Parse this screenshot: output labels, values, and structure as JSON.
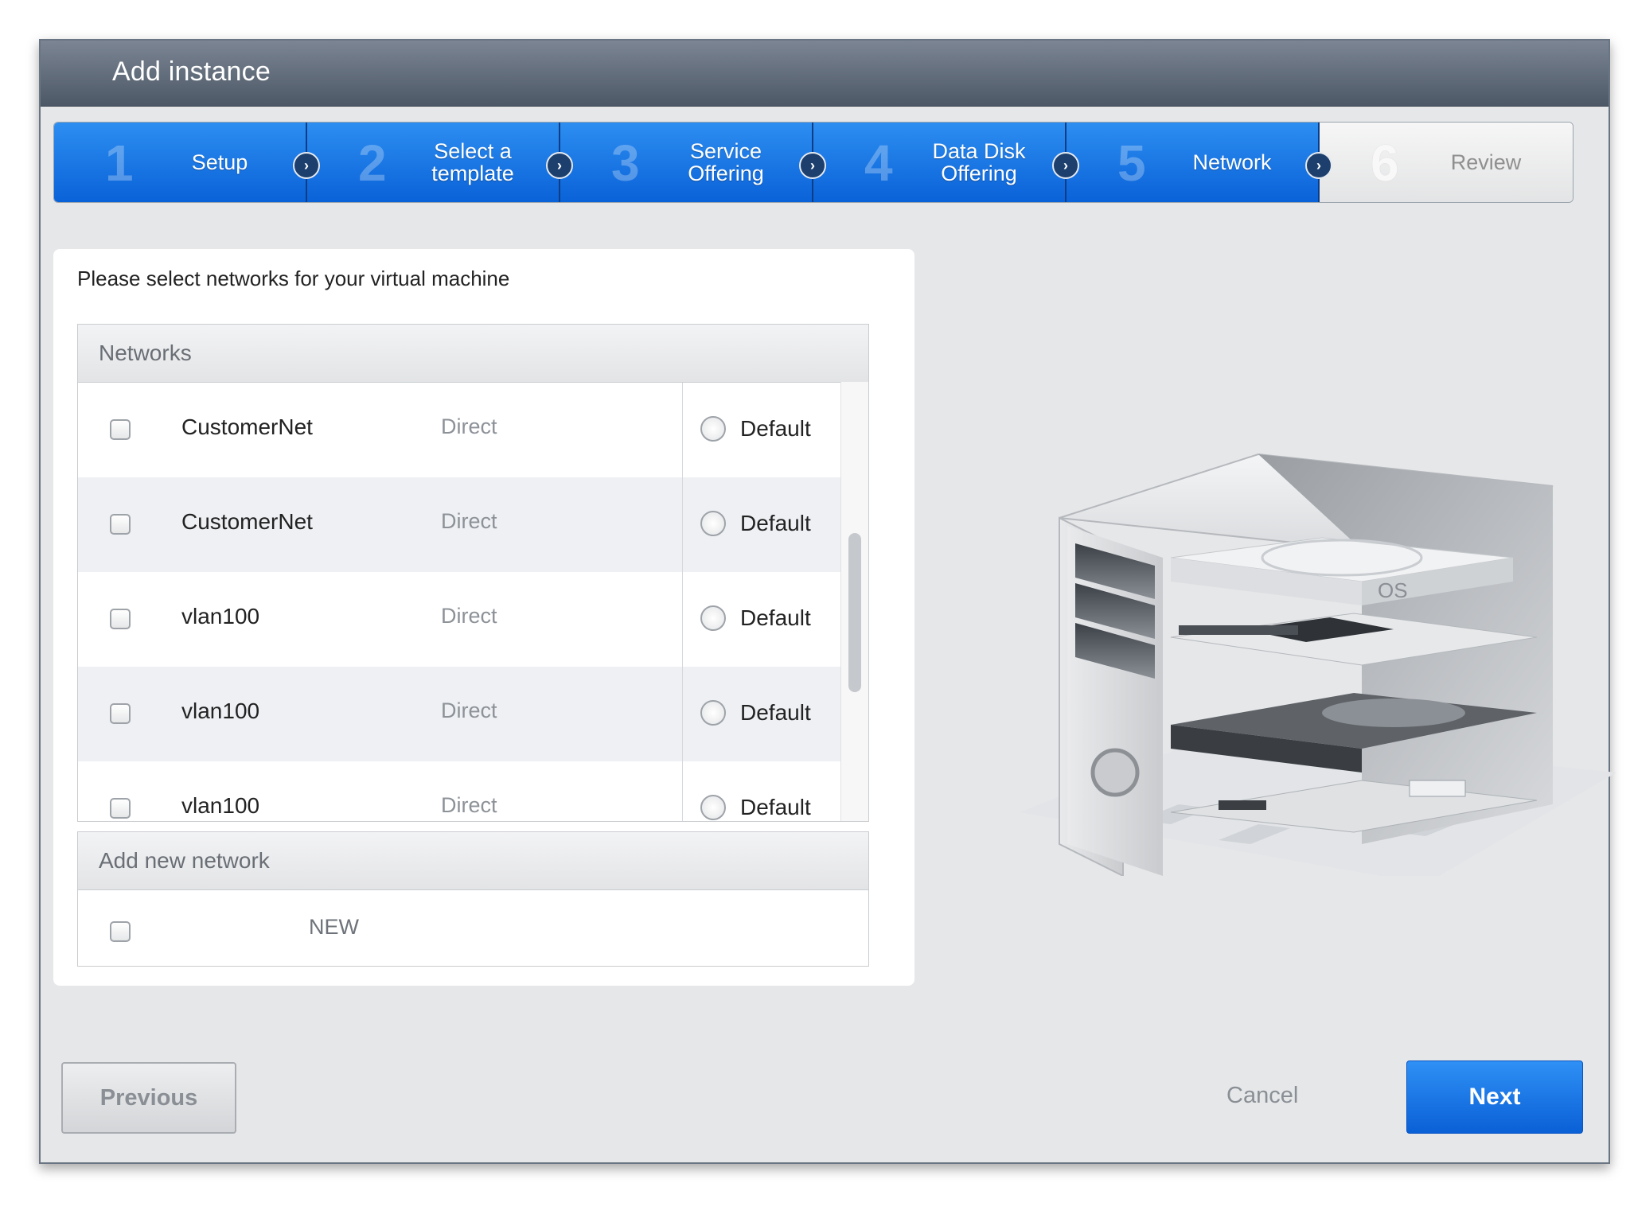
{
  "dialog": {
    "title": "Add instance"
  },
  "steps": [
    {
      "num": "1",
      "label": "Setup"
    },
    {
      "num": "2",
      "label": "Select a template"
    },
    {
      "num": "3",
      "label": "Service Offering"
    },
    {
      "num": "4",
      "label": "Data Disk Offering"
    },
    {
      "num": "5",
      "label": "Network"
    },
    {
      "num": "6",
      "label": "Review"
    }
  ],
  "network_panel": {
    "instruction": "Please select networks for your virtual machine",
    "section_title": "Networks",
    "rows": [
      {
        "name": "CustomerNet",
        "type": "Direct",
        "default_label": "Default"
      },
      {
        "name": "CustomerNet",
        "type": "Direct",
        "default_label": "Default"
      },
      {
        "name": "vlan100",
        "type": "Direct",
        "default_label": "Default"
      },
      {
        "name": "vlan100",
        "type": "Direct",
        "default_label": "Default"
      },
      {
        "name": "vlan100",
        "type": "Direct",
        "default_label": "Default"
      }
    ],
    "add_section_title": "Add new network",
    "add_label": "NEW"
  },
  "illustration": {
    "os_label": "OS"
  },
  "footer": {
    "previous": "Previous",
    "cancel": "Cancel",
    "next": "Next"
  },
  "colors": {
    "accent": "#0a62d8",
    "title_bar": "#5a6472",
    "dialog_bg": "#e6e7e9"
  }
}
